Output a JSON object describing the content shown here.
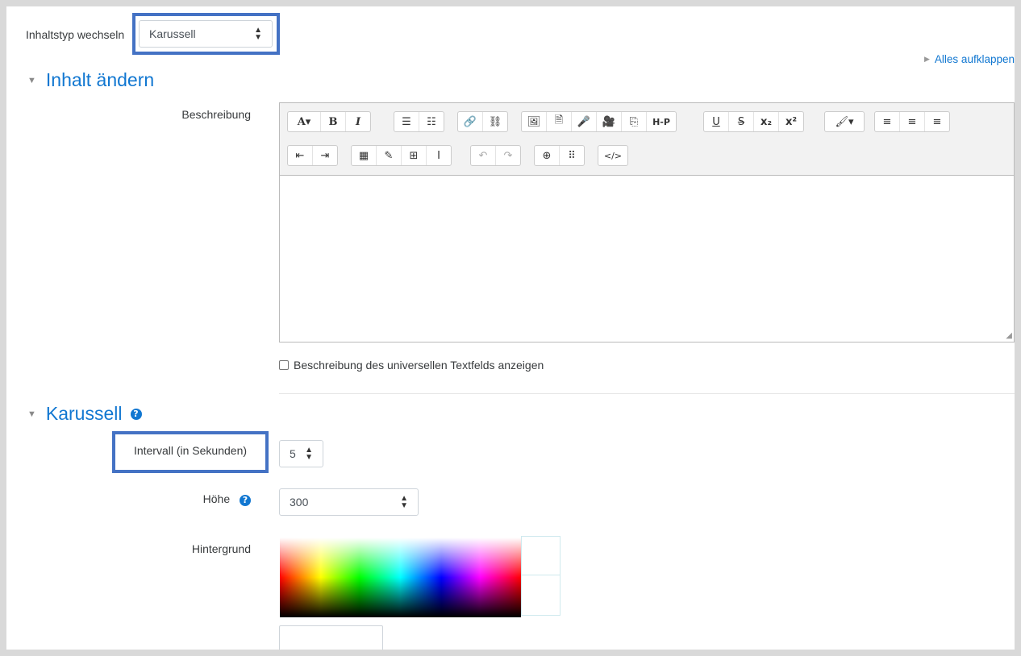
{
  "content_type": {
    "label": "Inhaltstyp wechseln",
    "value": "Karussell"
  },
  "expand_all": "Alles aufklappen",
  "section_edit": {
    "title": "Inhalt ändern"
  },
  "description": {
    "label": "Beschreibung"
  },
  "toolbar": {
    "row1": [
      [
        "A▾",
        "B",
        "I"
      ],
      [
        "☰",
        "☷"
      ],
      [
        "🔗",
        "⛓"
      ],
      [
        "🖼",
        "🗎",
        "🎤",
        "🎥",
        "⎘",
        "H-P"
      ],
      [
        "U",
        "S",
        "x₂",
        "x²"
      ],
      [
        "🖌▾"
      ],
      [
        "≡",
        "≡",
        "≡"
      ]
    ],
    "row2": [
      [
        "⇤",
        "⇥"
      ],
      [
        "▦",
        "✎",
        "⊞",
        "Ι"
      ],
      [
        "↶",
        "↷"
      ],
      [
        "⊕",
        "⠿"
      ],
      [
        "</>"
      ]
    ]
  },
  "show_universal": {
    "label": "Beschreibung des universellen Textfelds anzeigen",
    "checked": false
  },
  "section_carousel": {
    "title": "Karussell"
  },
  "interval": {
    "label": "Intervall (in Sekunden)",
    "value": "5"
  },
  "height": {
    "label": "Höhe",
    "value": "300"
  },
  "background": {
    "label": "Hintergrund",
    "value": ""
  },
  "colors": {
    "accent": "#1177d1",
    "highlight": "#4472c4"
  }
}
